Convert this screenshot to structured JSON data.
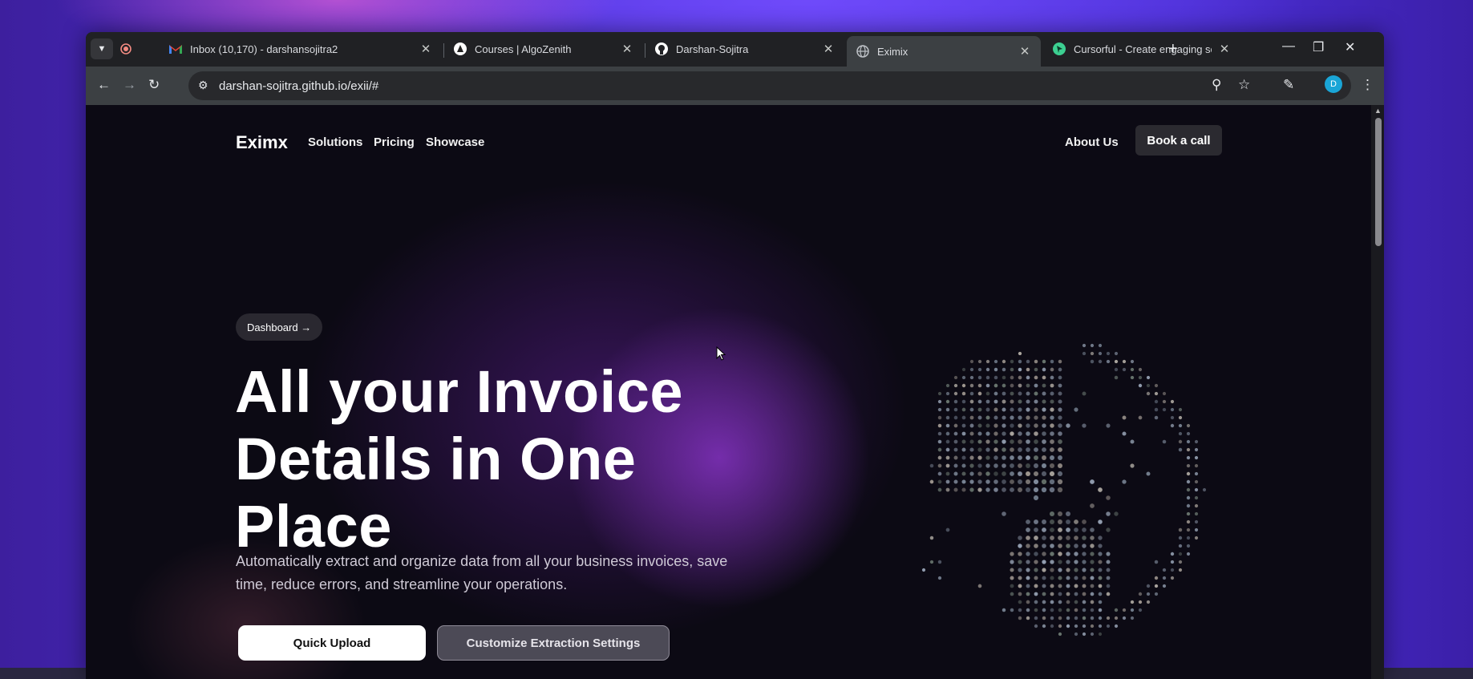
{
  "browser": {
    "tabs": [
      {
        "title": "Inbox (10,170) - darshansojitra2",
        "icon": "gmail-icon"
      },
      {
        "title": "Courses | AlgoZenith",
        "icon": "algozenith-icon"
      },
      {
        "title": "Darshan-Sojitra",
        "icon": "github-icon"
      },
      {
        "title": "Eximix",
        "icon": "globe-icon",
        "active": true
      },
      {
        "title": "Cursorful - Create engaging scr",
        "icon": "cursorful-icon"
      }
    ],
    "url": "darshan-sojitra.github.io/exii/#",
    "profile_initial": "D"
  },
  "site": {
    "logo": "Eximx",
    "nav": [
      "Solutions",
      "Pricing",
      "Showcase"
    ],
    "about": "About Us",
    "cta": "Book a call",
    "pill": "Dashboard →",
    "headline": [
      "All your Invoice",
      "Details in One",
      "Place"
    ],
    "subtext": "Automatically extract and organize data from all your business invoices, save time, reduce errors, and streamline your operations.",
    "primary_button": "Quick Upload",
    "secondary_button": "Customize Extraction Settings"
  },
  "colors": {
    "page_bg": "#0c0a14",
    "accent_purple": "#8232be",
    "desktop_gradient": "#5a3cf0"
  }
}
